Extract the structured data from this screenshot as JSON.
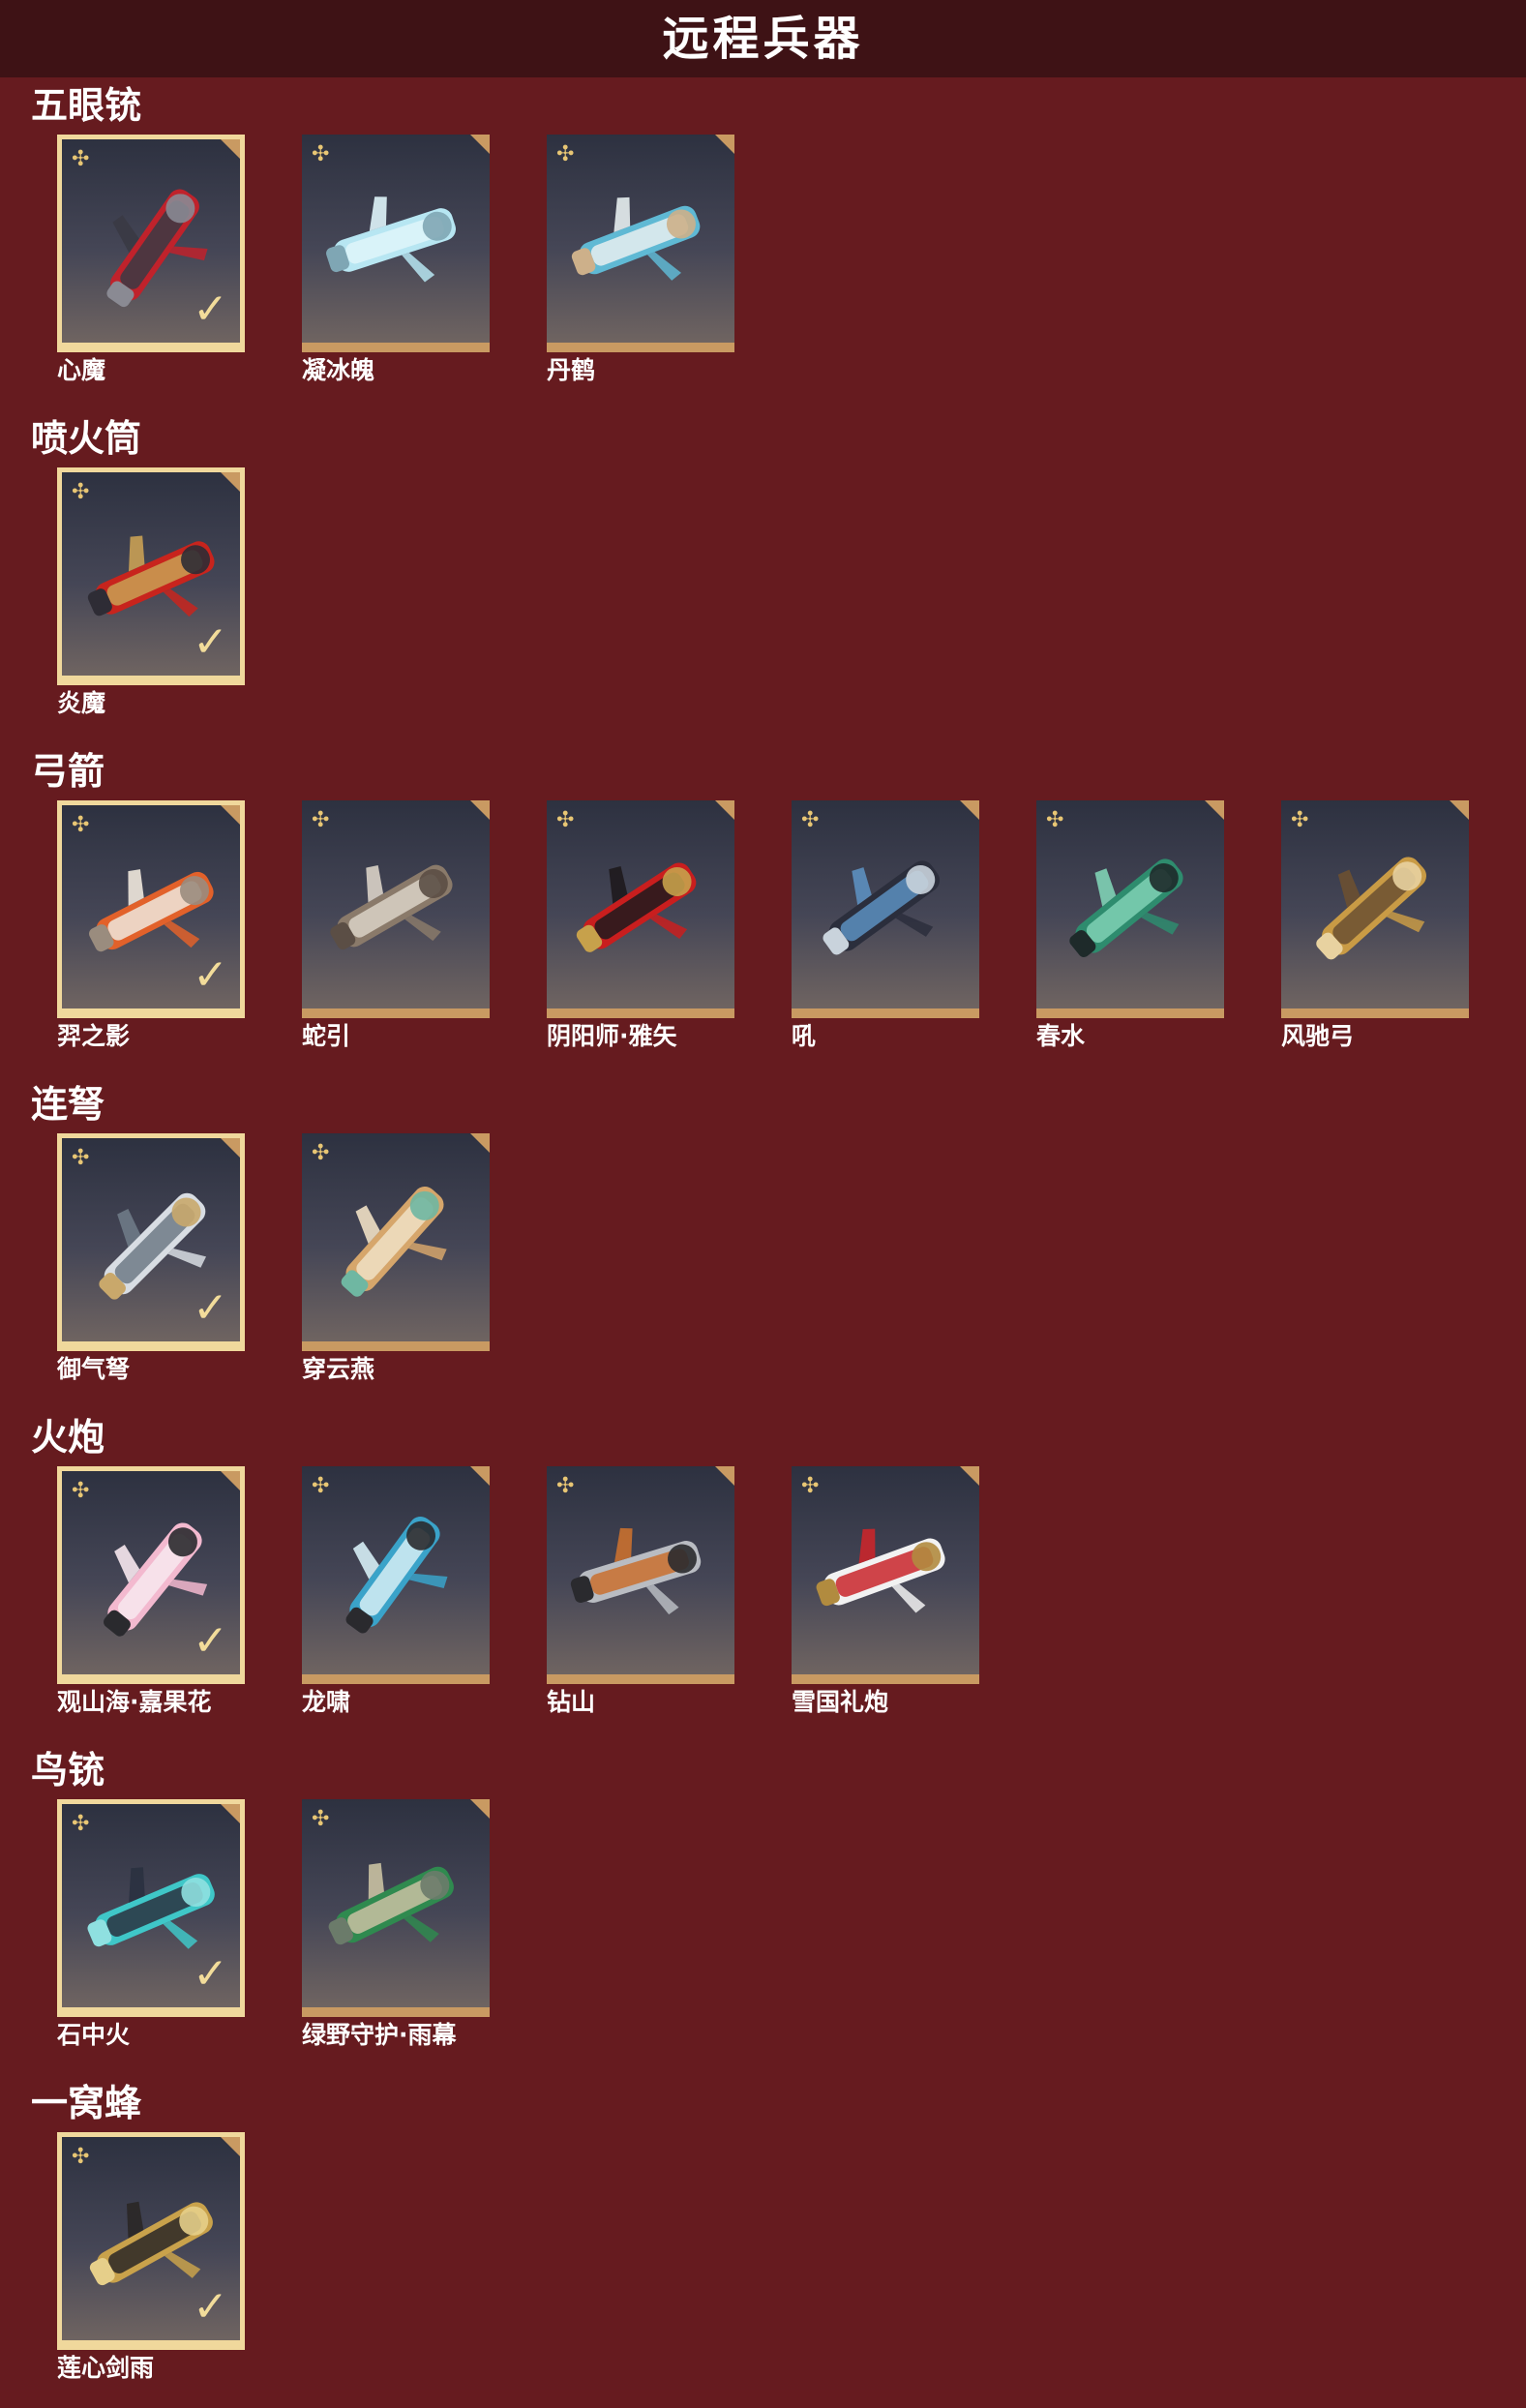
{
  "header": {
    "title": "远程兵器"
  },
  "icons": {
    "badge": "✣",
    "check": "✓"
  },
  "sections": [
    {
      "title": "五眼铳",
      "items": [
        {
          "name": "心魔",
          "selected": true,
          "colors": [
            "#c0222b",
            "#3a3a44",
            "#8a8a93"
          ]
        },
        {
          "name": "凝冰魄",
          "selected": false,
          "colors": [
            "#b7e6f2",
            "#dff4fa",
            "#7fa6b4"
          ]
        },
        {
          "name": "丹鹤",
          "selected": false,
          "colors": [
            "#5fb9d4",
            "#e7eef0",
            "#cdb08a"
          ]
        }
      ]
    },
    {
      "title": "喷火筒",
      "items": [
        {
          "name": "炎魔",
          "selected": true,
          "colors": [
            "#c8241d",
            "#c9a054",
            "#2e2c35"
          ]
        }
      ]
    },
    {
      "title": "弓箭",
      "items": [
        {
          "name": "羿之影",
          "selected": true,
          "colors": [
            "#e2612a",
            "#efe8dd",
            "#9a8c7e"
          ]
        },
        {
          "name": "蛇引",
          "selected": false,
          "colors": [
            "#8a7a6a",
            "#d9d2c6",
            "#5b4e45"
          ]
        },
        {
          "name": "阴阳师·雅矢",
          "selected": false,
          "colors": [
            "#c91e1e",
            "#1e1a1d",
            "#c7a14b"
          ]
        },
        {
          "name": "吼",
          "selected": false,
          "colors": [
            "#2b2e3c",
            "#5c8fbf",
            "#c9d3dc"
          ]
        },
        {
          "name": "春水",
          "selected": false,
          "colors": [
            "#2e8c6e",
            "#7fd1b5",
            "#1e2a2a"
          ]
        },
        {
          "name": "风驰弓",
          "selected": false,
          "colors": [
            "#c99b45",
            "#6b5031",
            "#e8d2a0"
          ]
        }
      ]
    },
    {
      "title": "连弩",
      "items": [
        {
          "name": "御气弩",
          "selected": true,
          "colors": [
            "#d8dde3",
            "#6e7a86",
            "#c9a86b"
          ]
        },
        {
          "name": "穿云燕",
          "selected": false,
          "colors": [
            "#d6a66b",
            "#f0e0c4",
            "#6fb7a2"
          ]
        }
      ]
    },
    {
      "title": "火炮",
      "items": [
        {
          "name": "观山海·嘉果花",
          "selected": true,
          "colors": [
            "#f3b9cf",
            "#f7e8ee",
            "#2a2a2e"
          ]
        },
        {
          "name": "龙啸",
          "selected": false,
          "colors": [
            "#3aa3c9",
            "#d6eef5",
            "#2a2a2e"
          ]
        },
        {
          "name": "钻山",
          "selected": false,
          "colors": [
            "#b9bcc2",
            "#c9702f",
            "#2a2a2e"
          ]
        },
        {
          "name": "雪国礼炮",
          "selected": false,
          "colors": [
            "#f2f2f2",
            "#c9262b",
            "#b18b3f"
          ]
        }
      ]
    },
    {
      "title": "鸟铳",
      "items": [
        {
          "name": "石中火",
          "selected": true,
          "colors": [
            "#3fc7c8",
            "#2a3140",
            "#8fe0e0"
          ]
        },
        {
          "name": "绿野守护·雨幕",
          "selected": false,
          "colors": [
            "#2f8a4f",
            "#c9c1a2",
            "#6b7b6a"
          ]
        }
      ]
    },
    {
      "title": "一窝蜂",
      "items": [
        {
          "name": "莲心剑雨",
          "selected": true,
          "colors": [
            "#c9a24b",
            "#2a2726",
            "#e6cf8a"
          ]
        }
      ]
    }
  ]
}
